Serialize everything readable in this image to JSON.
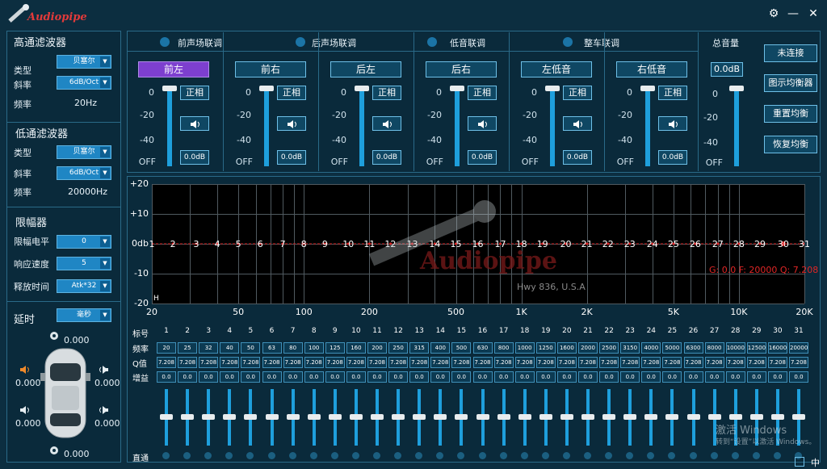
{
  "app": {
    "brand": "Audiopipe",
    "tagline": "Hwy 836, U.S.A"
  },
  "window": {
    "settings_icon": "gear-icon",
    "min_icon": "minimize-icon",
    "close_icon": "close-icon"
  },
  "hpf": {
    "title": "高通滤波器",
    "type_label": "类型",
    "type_value": "贝塞尔",
    "slope_label": "斜率",
    "slope_value": "6dB/Oct",
    "freq_label": "频率",
    "freq_value": "20Hz"
  },
  "lpf": {
    "title": "低通滤波器",
    "type_label": "类型",
    "type_value": "贝塞尔",
    "slope_label": "斜率",
    "slope_value": "6dB/Oct",
    "freq_label": "频率",
    "freq_value": "20000Hz"
  },
  "limiter": {
    "title": "限幅器",
    "level_label": "限幅电平",
    "level_value": "0",
    "speed_label": "响应速度",
    "speed_value": "5",
    "release_label": "释放时间",
    "release_value": "Atk*32"
  },
  "delay": {
    "label": "延时",
    "unit_value": "毫秒",
    "top": "0.000",
    "fl": "0.000",
    "fr": "0.000",
    "rl": "0.000",
    "rr": "0.000",
    "bottom": "0.000"
  },
  "links": {
    "front": "前声场联调",
    "rear": "后声场联调",
    "sub": "低音联调",
    "all": "整车联调",
    "master": "总音量"
  },
  "channels": [
    {
      "name": "前左",
      "selected": true,
      "phase": "正相",
      "db": "0.0dB",
      "level": 0
    },
    {
      "name": "前右",
      "selected": false,
      "phase": "正相",
      "db": "0.0dB",
      "level": 0
    },
    {
      "name": "后左",
      "selected": false,
      "phase": "正相",
      "db": "0.0dB",
      "level": 0
    },
    {
      "name": "后右",
      "selected": false,
      "phase": "正相",
      "db": "0.0dB",
      "level": 0
    },
    {
      "name": "左低音",
      "selected": false,
      "phase": "正相",
      "db": "0.0dB",
      "level": 0
    },
    {
      "name": "右低音",
      "selected": false,
      "phase": "正相",
      "db": "0.0dB",
      "level": 0
    }
  ],
  "scale": [
    "0",
    "-20",
    "-40",
    "OFF"
  ],
  "master": {
    "db": "0.0dB"
  },
  "right_buttons": {
    "connect": "未连接",
    "graphic_eq": "图示均衡器",
    "reset_eq": "重置均衡",
    "restore_eq": "恢复均衡"
  },
  "chart_data": {
    "type": "line",
    "ylim": [
      -20,
      20
    ],
    "yticks": [
      "+20",
      "+10",
      "0db",
      "-10",
      "-20"
    ],
    "xticks": [
      "20",
      "50",
      "100",
      "200",
      "500",
      "1K",
      "2K",
      "5K",
      "10K",
      "20K"
    ],
    "band_labels": [
      "1",
      "2",
      "3",
      "4",
      "5",
      "6",
      "7",
      "8",
      "9",
      "10",
      "11",
      "12",
      "13",
      "14",
      "15",
      "16",
      "17",
      "18",
      "19",
      "20",
      "21",
      "22",
      "23",
      "24",
      "25",
      "26",
      "27",
      "28",
      "29",
      "30",
      "31"
    ],
    "series": [
      {
        "values": [
          0,
          0,
          0,
          0,
          0,
          0,
          0,
          0,
          0,
          0,
          0,
          0,
          0,
          0,
          0,
          0,
          0,
          0,
          0,
          0,
          0,
          0,
          0,
          0,
          0,
          0,
          0,
          0,
          0,
          0,
          0
        ]
      }
    ],
    "annotation": "G: 0.0  F: 20000  Q: 7.208",
    "corner": "H"
  },
  "table": {
    "num_label": "标号",
    "freq_label": "频率",
    "q_label": "Q值",
    "gain_label": "增益",
    "bypass_label": "直通",
    "nums": [
      "1",
      "2",
      "3",
      "4",
      "5",
      "6",
      "7",
      "8",
      "9",
      "10",
      "11",
      "12",
      "13",
      "14",
      "15",
      "16",
      "17",
      "18",
      "19",
      "20",
      "21",
      "22",
      "23",
      "24",
      "25",
      "26",
      "27",
      "28",
      "29",
      "30",
      "31"
    ],
    "freqs": [
      "20",
      "25",
      "32",
      "40",
      "50",
      "63",
      "80",
      "100",
      "125",
      "160",
      "200",
      "250",
      "315",
      "400",
      "500",
      "630",
      "800",
      "1000",
      "1250",
      "1600",
      "2000",
      "2500",
      "3150",
      "4000",
      "5000",
      "6300",
      "8000",
      "10000",
      "12500",
      "16000",
      "20000"
    ],
    "qs": [
      "7.208",
      "7.208",
      "7.208",
      "7.208",
      "7.208",
      "7.208",
      "7.208",
      "7.208",
      "7.208",
      "7.208",
      "7.208",
      "7.208",
      "7.208",
      "7.208",
      "7.208",
      "7.208",
      "7.208",
      "7.208",
      "7.208",
      "7.208",
      "7.208",
      "7.208",
      "7.208",
      "7.208",
      "7.208",
      "7.208",
      "7.208",
      "7.208",
      "7.208",
      "7.208",
      "7.208"
    ],
    "gains": [
      "0.0",
      "0.0",
      "0.0",
      "0.0",
      "0.0",
      "0.0",
      "0.0",
      "0.0",
      "0.0",
      "0.0",
      "0.0",
      "0.0",
      "0.0",
      "0.0",
      "0.0",
      "0.0",
      "0.0",
      "0.0",
      "0.0",
      "0.0",
      "0.0",
      "0.0",
      "0.0",
      "0.0",
      "0.0",
      "0.0",
      "0.0",
      "0.0",
      "0.0",
      "0.0",
      "0.0"
    ]
  },
  "watermark": {
    "line1": "激活 Windows",
    "line2": "转到“设置”以激活 Windows。"
  },
  "tray": {
    "ime": "中"
  }
}
